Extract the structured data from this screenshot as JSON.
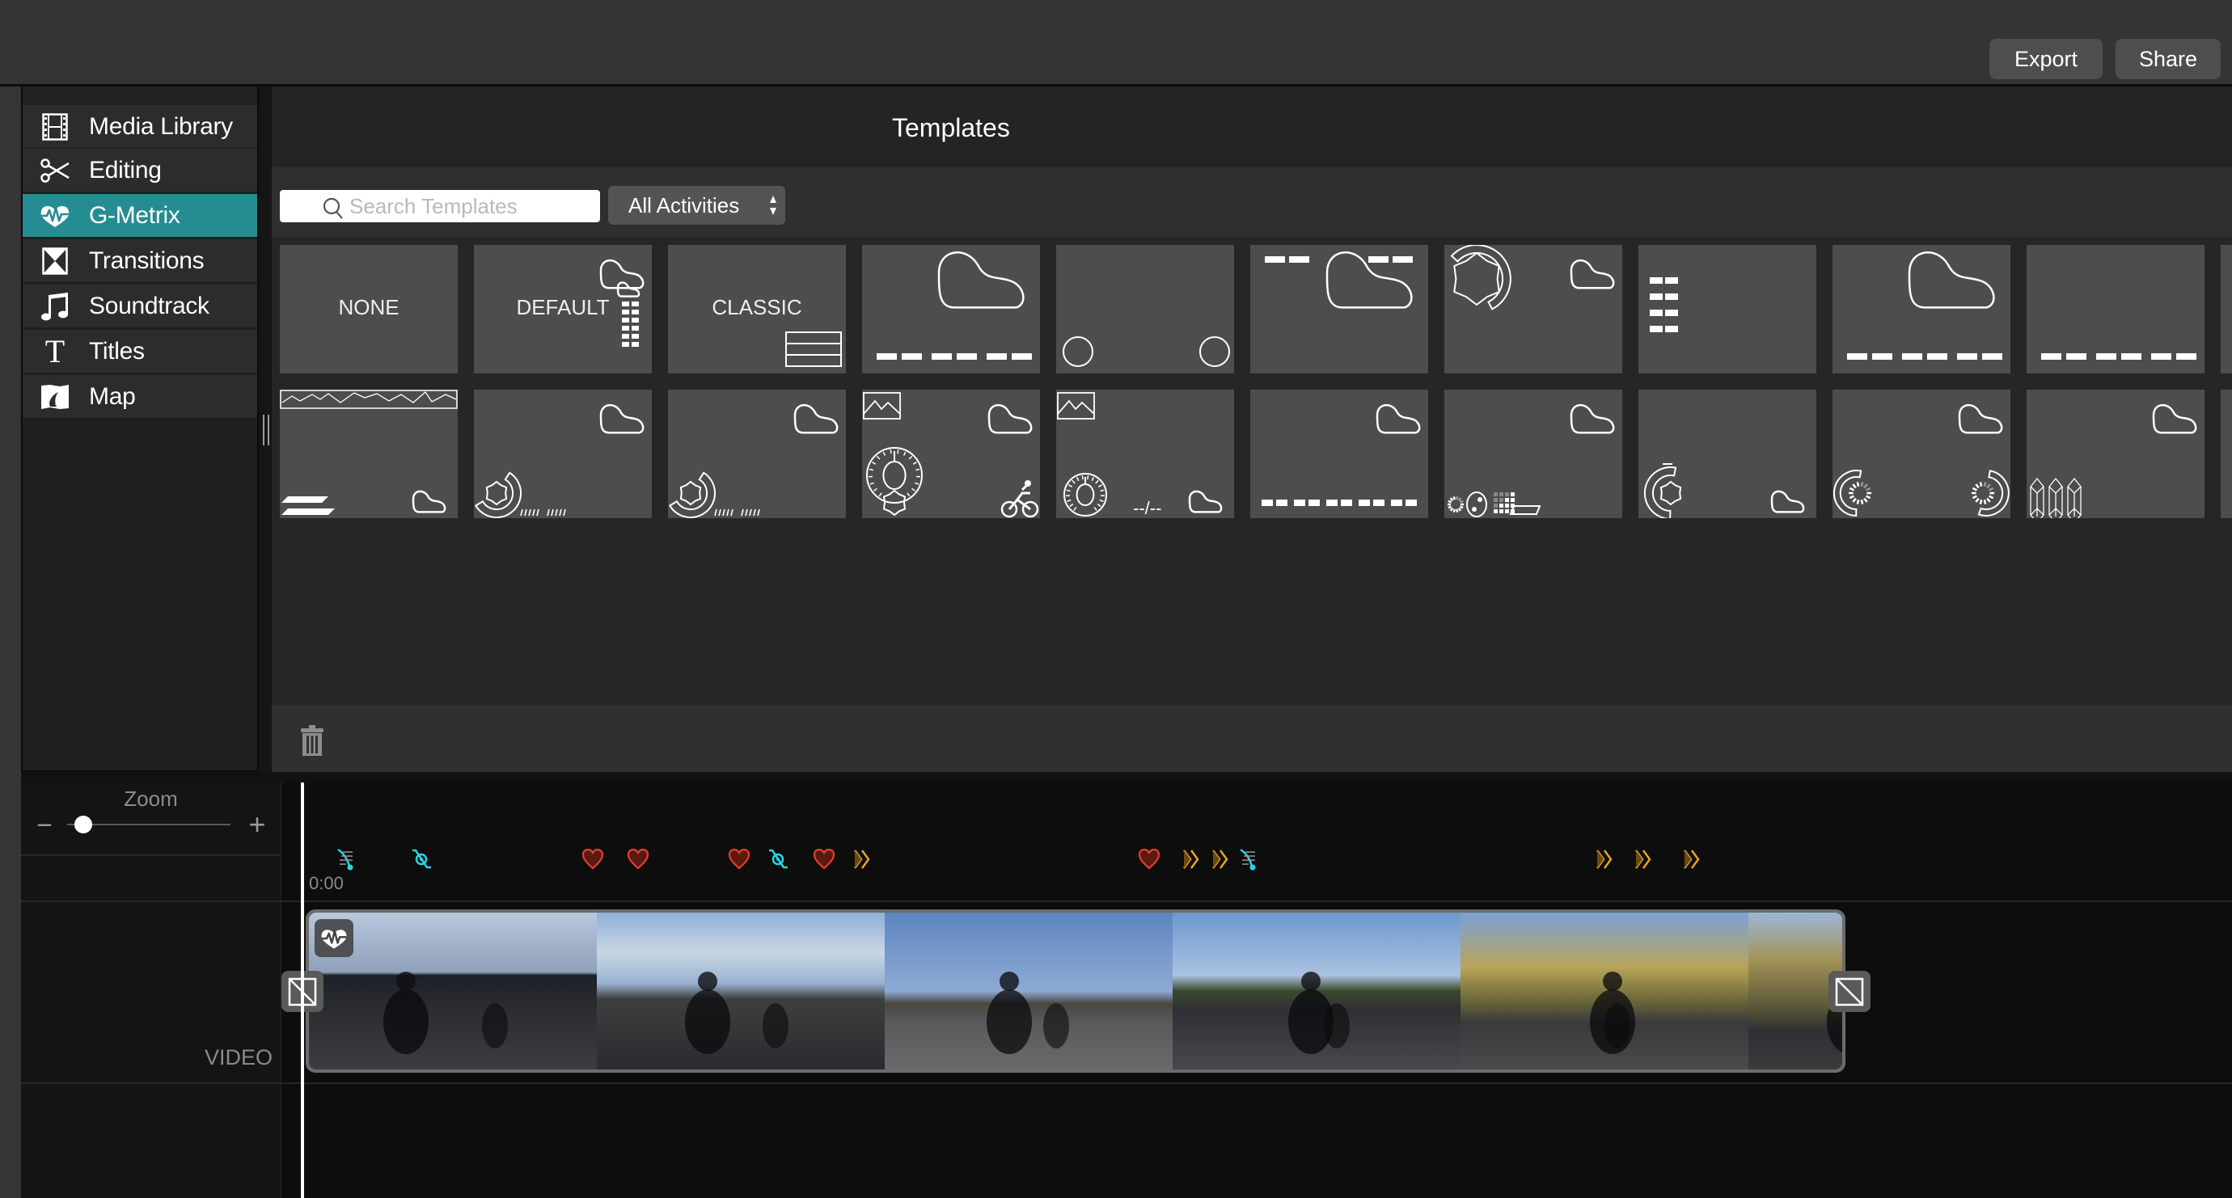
{
  "header": {
    "export_label": "Export",
    "share_label": "Share"
  },
  "sidebar": {
    "items": [
      {
        "label": "Media Library",
        "icon": "film-strip-icon",
        "active": false
      },
      {
        "label": "Editing",
        "icon": "scissors-icon",
        "active": false
      },
      {
        "label": "G-Metrix",
        "icon": "gmetrix-pulse-icon",
        "active": true
      },
      {
        "label": "Transitions",
        "icon": "hourglass-transition-icon",
        "active": false
      },
      {
        "label": "Soundtrack",
        "icon": "music-note-icon",
        "active": false
      },
      {
        "label": "Titles",
        "icon": "text-t-icon",
        "active": false
      },
      {
        "label": "Map",
        "icon": "map-icon",
        "active": false
      }
    ],
    "active_color": "#258d92"
  },
  "templates": {
    "title": "Templates",
    "search": {
      "placeholder": "Search Templates",
      "value": ""
    },
    "activity_filter": {
      "selected": "All Activities"
    },
    "rows": [
      [
        {
          "label": "NONE",
          "graphics": []
        },
        {
          "label": "DEFAULT",
          "graphics": [
            "track-map",
            "data-list"
          ]
        },
        {
          "label": "CLASSIC",
          "graphics": [
            "stacked-panel"
          ]
        },
        {
          "label": "",
          "graphics": [
            "track-map-large",
            "data-bar-6"
          ]
        },
        {
          "label": "",
          "graphics": [
            "circle-gauge-left",
            "circle-gauge-right"
          ]
        },
        {
          "label": "",
          "graphics": [
            "data-pairs-top",
            "track-map-large"
          ]
        },
        {
          "label": "",
          "graphics": [
            "gear-ring-gauge",
            "track-map"
          ]
        },
        {
          "label": "",
          "graphics": [
            "data-list-4"
          ]
        },
        {
          "label": "",
          "graphics": [
            "track-map-large",
            "data-bar-6"
          ]
        },
        {
          "label": "",
          "graphics": [
            "data-bar-6"
          ]
        },
        {
          "label": "",
          "graphics": [
            "partial"
          ]
        }
      ],
      [
        {
          "label": "",
          "graphics": [
            "elevation-profile",
            "lane-bars",
            "track-map-small"
          ]
        },
        {
          "label": "",
          "graphics": [
            "gear-arc-gauge",
            "tick-bars",
            "track-map"
          ]
        },
        {
          "label": "",
          "graphics": [
            "gear-arc-gauge",
            "tick-bars",
            "track-map"
          ]
        },
        {
          "label": "",
          "graphics": [
            "photo",
            "track-map",
            "speedometer-gear",
            "cyclist"
          ]
        },
        {
          "label": "",
          "graphics": [
            "photo",
            "speedometer",
            "lap-time",
            "track-map-small"
          ]
        },
        {
          "label": "",
          "graphics": [
            "track-map",
            "data-bar-5"
          ]
        },
        {
          "label": "",
          "graphics": [
            "track-map",
            "dial-dots-grid",
            "parallelogram"
          ]
        },
        {
          "label": "",
          "graphics": [
            "arc-gear-gauge",
            "track-map-small"
          ]
        },
        {
          "label": "",
          "graphics": [
            "track-map",
            "dual-arc-gauges"
          ]
        },
        {
          "label": "",
          "graphics": [
            "track-map",
            "crystal-bars"
          ]
        },
        {
          "label": "",
          "graphics": [
            "partial"
          ]
        }
      ]
    ],
    "lap_time_text": "--/--"
  },
  "timeline": {
    "zoom_label": "Zoom",
    "zoom_minus": "−",
    "zoom_plus": "+",
    "zoom_level": 0.1,
    "start_time": "0:00",
    "track_label": "VIDEO",
    "markers": [
      {
        "type": "speed",
        "color": "#27d6e4"
      },
      {
        "type": "g-force",
        "color": "#27d6e4"
      },
      {
        "type": "heart-rate",
        "color": "#e0402c"
      },
      {
        "type": "heart-rate",
        "color": "#e0402c"
      },
      {
        "type": "heart-rate",
        "color": "#e0402c"
      },
      {
        "type": "g-force",
        "color": "#27d6e4"
      },
      {
        "type": "heart-rate",
        "color": "#e0402c"
      },
      {
        "type": "fast-forward",
        "color": "#e8a423"
      },
      {
        "type": "heart-rate",
        "color": "#e0402c"
      },
      {
        "type": "fast-forward",
        "color": "#e8a423"
      },
      {
        "type": "fast-forward",
        "color": "#e8a423"
      },
      {
        "type": "speed",
        "color": "#27d6e4"
      },
      {
        "type": "fast-forward",
        "color": "#e8a423"
      },
      {
        "type": "fast-forward",
        "color": "#e8a423"
      },
      {
        "type": "fast-forward",
        "color": "#e8a423"
      }
    ],
    "clip": {
      "thumbnails": [
        "cyclists-on-curved-road-dusk",
        "cyclists-under-cloudy-sky",
        "empty-highway-shadows",
        "cyclists-at-traffic-light",
        "cyclists-on-tree-lined-road",
        "trees-beside-road"
      ]
    }
  }
}
